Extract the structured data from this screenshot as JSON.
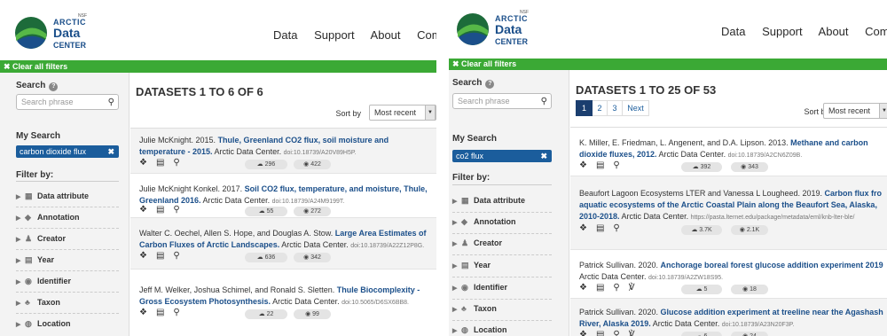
{
  "brand": {
    "nsf": "NSF",
    "line1": "ARCTIC",
    "line2": "Data",
    "line3": "CENTER"
  },
  "colors": {
    "green": "#3ba935",
    "navy": "#1b5d9c",
    "title_blue": "#1b4f8a"
  },
  "left": {
    "nav": [
      "Data",
      "Support",
      "About",
      "Communi"
    ],
    "clear_filters": "✖ Clear all filters",
    "search_label": "Search",
    "search_placeholder": "Search phrase",
    "my_search_label": "My Search",
    "chip": "carbon dioxide flux",
    "filter_by": "Filter by:",
    "facets": [
      "Data attribute",
      "Annotation",
      "Creator",
      "Year",
      "Identifier",
      "Taxon",
      "Location"
    ],
    "count": "DATASETS 1 TO 6 OF 6",
    "sort_by": "Sort by",
    "sort_value": "Most recent",
    "rows": [
      {
        "pre": "Julie McKnight. 2015. ",
        "title": "Thule, Greenland CO2 flux, soil moisture and temperature - 2015.",
        "post": " Arctic Data Center. ",
        "doi": "doi:10.18739/A20V89H5P.",
        "downloads": "296",
        "views": "422"
      },
      {
        "pre": "Julie McKnight Konkel. 2017. ",
        "title": "Soil CO2 flux, temperature, and moisture, Thule, Greenland 2016.",
        "post": " Arctic Data Center. ",
        "doi": "doi:10.18739/A24M9199T.",
        "downloads": "55",
        "views": "272"
      },
      {
        "pre": "Walter C. Oechel, Allen S. Hope, and Douglas A. Stow. ",
        "title": "Large Area Estimates of Carbon Fluxes of Arctic Landscapes.",
        "post": " Arctic Data Center. ",
        "doi": "doi:10.18739/A22Z12P8G.",
        "downloads": "636",
        "views": "342"
      },
      {
        "pre": "Jeff M. Welker, Joshua Schimel, and Ronald S. Sletten. ",
        "title": "Thule Biocomplexity - Gross Ecosystem Photosynthesis.",
        "post": " Arctic Data Center. ",
        "doi": "doi:10.5065/D6SX6BB8.",
        "downloads": "22",
        "views": "99"
      }
    ]
  },
  "right": {
    "nav": [
      "Data",
      "Support",
      "About",
      "Commun"
    ],
    "clear_filters": "✖ Clear all filters",
    "search_label": "Search",
    "search_placeholder": "Search phrase",
    "my_search_label": "My Search",
    "chip": "co2 flux",
    "filter_by": "Filter by:",
    "facets": [
      "Data attribute",
      "Annotation",
      "Creator",
      "Year",
      "Identifier",
      "Taxon",
      "Location"
    ],
    "count": "DATASETS 1 TO 25 OF 53",
    "pages": [
      "1",
      "2",
      "3",
      "Next"
    ],
    "sort_by": "Sort by",
    "sort_value": "Most recent",
    "rows": [
      {
        "pre": "K. Miller, E. Friedman, L. Angenent, and D.A. Lipson. 2013. ",
        "title": "Methane and carbon dioxide fluxes, 2012.",
        "post": " Arctic Data Center. ",
        "doi": "doi:10.18739/A2CN6Z09B.",
        "downloads": "392",
        "views": "343"
      },
      {
        "pre": "Beaufort Lagoon Ecosystems LTER and Vanessa L Lougheed. 2019. ",
        "title": "Carbon flux fro aquatic ecosystems of the Arctic Coastal Plain along the Beaufort Sea, Alaska, 2010-2018.",
        "post": " Arctic Data Center. ",
        "doi": "https://pasta.lternet.edu/package/metadata/eml/knb-lter-ble/",
        "downloads": "3.7K",
        "views": "2.1K"
      },
      {
        "pre": "Patrick Sullivan. 2020. ",
        "title": "Anchorage boreal forest glucose addition experiment 2019",
        "post": " Arctic Data Center. ",
        "doi": "doi:10.18739/A2ZW18S95.",
        "downloads": "5",
        "views": "18"
      },
      {
        "pre": "Patrick Sullivan. 2020. ",
        "title": "Glucose addition experiment at treeline near the Agashash River, Alaska 2019.",
        "post": " Arctic Data Center. ",
        "doi": "doi:10.18739/A23N20F3P.",
        "downloads": "6",
        "views": "24"
      }
    ]
  }
}
